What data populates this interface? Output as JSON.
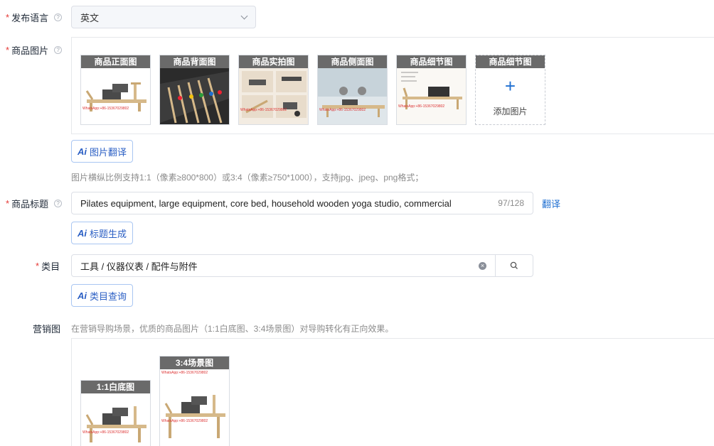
{
  "language": {
    "label": "发布语言",
    "value": "英文"
  },
  "images": {
    "label": "商品图片",
    "thumbs": [
      {
        "caption": "商品正面图"
      },
      {
        "caption": "商品背面图"
      },
      {
        "caption": "商品实拍图"
      },
      {
        "caption": "商品侧面图"
      },
      {
        "caption": "商品细节图"
      }
    ],
    "add_slot": {
      "caption": "商品细节图",
      "plus": "+",
      "text": "添加图片"
    },
    "watermark": "WhatsApp:+86-15367029802",
    "ai_button": {
      "icon": "Ai",
      "label": "图片翻译"
    },
    "hint": "图片横纵比例支持1:1（像素≥800*800）或3:4（像素≥750*1000），支持jpg、jpeg、png格式；"
  },
  "title": {
    "label": "商品标题",
    "value": "Pilates equipment, large equipment, core bed, household wooden yoga studio, commercial",
    "count": "97/128",
    "translate_link": "翻译",
    "ai_button": {
      "icon": "Ai",
      "label": "标题生成"
    }
  },
  "category": {
    "label": "类目",
    "value": "工具 / 仪器仪表 / 配件与附件",
    "ai_button": {
      "icon": "Ai",
      "label": "类目查询"
    }
  },
  "marketing": {
    "label": "营销图",
    "hint": "在营销导购场景，优质的商品图片（1:1白底图、3:4场景图）对导购转化有正向效果。",
    "thumbs": [
      {
        "caption": "1:1白底图"
      },
      {
        "caption": "3:4场景图"
      }
    ]
  },
  "colors": {
    "accent": "#1f6fd1",
    "required": "#e53935",
    "wood": "#d6b98a",
    "dark": "#3a3a3a"
  }
}
